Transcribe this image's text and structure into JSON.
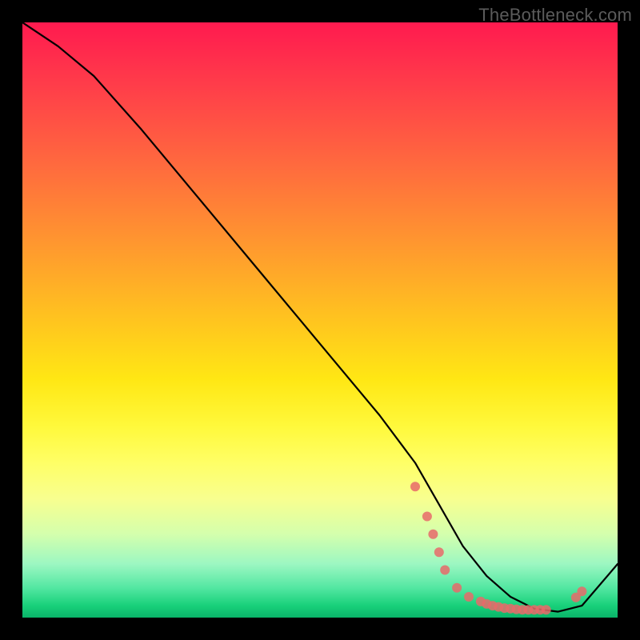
{
  "watermark": "TheBottleneck.com",
  "chart_data": {
    "type": "line",
    "title": "",
    "xlabel": "",
    "ylabel": "",
    "xlim": [
      0,
      100
    ],
    "ylim": [
      0,
      100
    ],
    "series": [
      {
        "name": "bottleneck-curve",
        "x": [
          0,
          6,
          12,
          20,
          30,
          40,
          50,
          60,
          66,
          70,
          74,
          78,
          82,
          86,
          90,
          94,
          100
        ],
        "y": [
          100,
          96,
          91,
          82,
          70,
          58,
          46,
          34,
          26,
          19,
          12,
          7,
          3.5,
          1.5,
          1,
          2,
          9
        ]
      }
    ],
    "markers": {
      "name": "highlighted-points",
      "color": "#e86a6a",
      "points": [
        {
          "x": 66,
          "y": 22
        },
        {
          "x": 68,
          "y": 17
        },
        {
          "x": 69,
          "y": 14
        },
        {
          "x": 70,
          "y": 11
        },
        {
          "x": 71,
          "y": 8
        },
        {
          "x": 73,
          "y": 5
        },
        {
          "x": 75,
          "y": 3.5
        },
        {
          "x": 77,
          "y": 2.7
        },
        {
          "x": 78,
          "y": 2.3
        },
        {
          "x": 79,
          "y": 2.0
        },
        {
          "x": 80,
          "y": 1.8
        },
        {
          "x": 81,
          "y": 1.6
        },
        {
          "x": 82,
          "y": 1.5
        },
        {
          "x": 83,
          "y": 1.4
        },
        {
          "x": 84,
          "y": 1.3
        },
        {
          "x": 85,
          "y": 1.3
        },
        {
          "x": 86,
          "y": 1.3
        },
        {
          "x": 87,
          "y": 1.3
        },
        {
          "x": 88,
          "y": 1.3
        },
        {
          "x": 93,
          "y": 3.4
        },
        {
          "x": 94,
          "y": 4.4
        }
      ]
    },
    "gradient_stops": [
      {
        "t": 0.0,
        "color": "#ff1a4f"
      },
      {
        "t": 0.5,
        "color": "#ffe714"
      },
      {
        "t": 0.8,
        "color": "#f8ff8f"
      },
      {
        "t": 1.0,
        "color": "#0ab469"
      }
    ]
  }
}
